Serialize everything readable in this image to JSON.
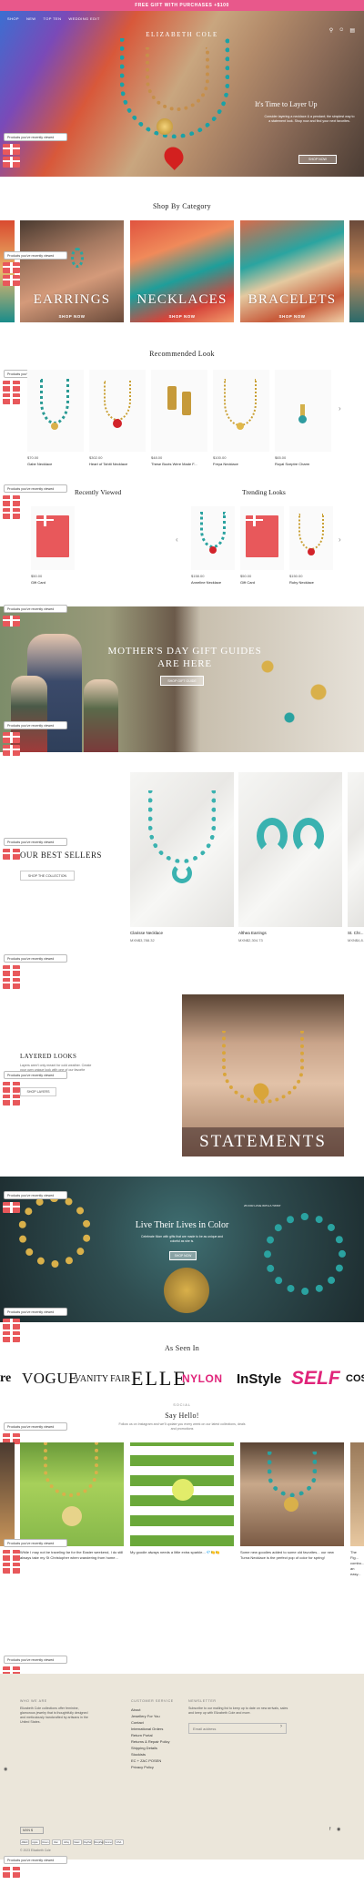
{
  "announcement": "FREE GIFT WITH PURCHASES +$100",
  "header": {
    "nav": [
      "SHOP",
      "NEW",
      "TOP TEN",
      "WEDDING EDIT"
    ],
    "logo": "ELIZABETH COLE",
    "icons": [
      "search-icon",
      "account-icon",
      "cart-icon"
    ]
  },
  "hero": {
    "title": "It's Time to Layer Up",
    "subtitle": "Consider layering a necklace & a pendant; the simplest way to a statement look. Shop now and find your next favorites.",
    "button": "SHOP NOW"
  },
  "recently_viewed": {
    "label": "Products you've recently viewed"
  },
  "categories": {
    "title": "Shop By Category",
    "items": [
      {
        "label": "EARRINGS",
        "shop": "SHOP NOW"
      },
      {
        "label": "NECKLACES",
        "shop": "SHOP NOW"
      },
      {
        "label": "BRACELETS",
        "shop": "SHOP NOW"
      }
    ]
  },
  "recommended": {
    "title": "Recommended Look",
    "products": [
      {
        "price": "$70.00",
        "name": "Gabe Necklace"
      },
      {
        "price": "$302.00",
        "name": "Heart of Tahiti Necklace"
      },
      {
        "price": "$48.00",
        "name": "These Boots Were Made F..."
      },
      {
        "price": "$100.00",
        "name": "Freya Necklace"
      },
      {
        "price": "$65.00",
        "name": "Royal Sceptre Charm"
      }
    ]
  },
  "recently_viewed_section": {
    "title": "Recently Viewed",
    "products": [
      {
        "price": "$50.00",
        "name": "Gift Card"
      }
    ]
  },
  "trending": {
    "title": "Trending Looks",
    "products": [
      {
        "price": "$158.00",
        "name": "Anneline Necklace"
      },
      {
        "price": "$50.00",
        "name": "Gift Card"
      },
      {
        "price": "$150.00",
        "name": "Ruby Necklace"
      }
    ]
  },
  "mothers_day": {
    "title": "MOTHER'S DAY GIFT GUIDES ARE HERE",
    "button": "SHOP GIFT GUIDE"
  },
  "best_sellers": {
    "title": "OUR BEST SELLERS",
    "button": "SHOP THE COLLECTION",
    "products": [
      {
        "name": "Clarisse Necklace",
        "price": "MXN$3,788.32"
      },
      {
        "name": "Althea Earrings",
        "price": "MXN$2,304.73"
      },
      {
        "name": "St. Chr...",
        "price": "MXN$4,8..."
      }
    ]
  },
  "layered": {
    "title": "LAYERED LOOKS",
    "subtitle": "Layers aren't only meant for cold weather. Create your own unique look with one of our favorite looks.",
    "button": "SHOP LAYERS",
    "banner": "STATEMENTS"
  },
  "live": {
    "title": "Live Their Lives in Color",
    "subtitle": "Celebrate Mom with gifts that are made to be as unique and colorful as she is.",
    "button": "SHOP NOW",
    "overlay": "25 FOR LOVE WITH A TWIST"
  },
  "press": {
    "title": "As Seen In",
    "logos": [
      "re",
      "VOGUE",
      "VANITY FAIR",
      "ELLE",
      "NYLON",
      "InStyle",
      "SELF",
      "COSM"
    ]
  },
  "social": {
    "kicker": "SOCIAL",
    "title": "Say Hello!",
    "subtitle": "Follow us on Instagram and we'll update you every week on our latest collections, deals and promotions",
    "posts": [
      {
        "caption": "While I may not be traveling far for the Easter weekend, I do still always take my St Christopher when wandering from home..."
      },
      {
        "caption": "My goodie always needs a little extra sparkle... 💎🍋🍋"
      },
      {
        "caption": "Some new goodies added to some old favorites... our new Turna Necklace is the perfect pop of color for spring!"
      },
      {
        "caption": "The Fig... combo... an easy..."
      }
    ]
  },
  "footer": {
    "who": {
      "heading": "WHO WE ARE",
      "text": "Elizabeth Cole collections offer feminine, glamorous jewelry that is thoughtfully designed and meticulously handcrafted by artisans in the United States."
    },
    "service": {
      "heading": "CUSTOMER SERVICE",
      "links": [
        "About",
        "Jewellery For You",
        "Contact",
        "International Orders",
        "Return Portal",
        "Returns & Repair Policy",
        "Shipping Details",
        "Stockists",
        "EC + ZAC POSEN",
        "Privacy Policy"
      ]
    },
    "newsletter": {
      "heading": "NEWSLETTER",
      "text": "Subscribe to our mailing list to keep up to date on new arrivals, sales and keep up with Elizabeth Cole and more.",
      "placeholder": "Email address"
    },
    "currency": "MXN $",
    "payments": [
      "AMEX",
      "Apple",
      "Diners",
      "Disc",
      "GPay",
      "Mastr",
      "PayPal",
      "ShopPay",
      "Venmo",
      "VISA"
    ],
    "copyright": "© 2023 Elizabeth Cole"
  }
}
